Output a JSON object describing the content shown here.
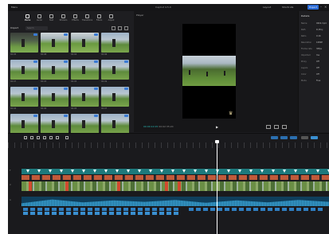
{
  "window": {
    "title": "CapCut 4.5.0",
    "export_label": "Export",
    "menu_left": "Menu",
    "layout_btn": "Layout",
    "shortcut_btn": "Shortcuts"
  },
  "media": {
    "tools": [
      {
        "label": "Media",
        "icon": "media-icon",
        "active": true
      },
      {
        "label": "Audio",
        "icon": "audio-icon"
      },
      {
        "label": "Text",
        "icon": "text-icon"
      },
      {
        "label": "Stickers",
        "icon": "sticker-icon"
      },
      {
        "label": "Effects",
        "icon": "effects-icon"
      },
      {
        "label": "Transitions",
        "icon": "transition-icon"
      },
      {
        "label": "Filters",
        "icon": "filter-icon"
      },
      {
        "label": "Adjust",
        "icon": "adjust-icon"
      }
    ],
    "import_label": "Import",
    "search_placeholder": "Search",
    "clips": [
      {
        "meta": "00:05",
        "style": "dark",
        "added": true
      },
      {
        "meta": "00:08",
        "style": "tall",
        "added": true
      },
      {
        "meta": "00:04",
        "style": "tall",
        "added": true
      },
      {
        "meta": "00:06",
        "style": "normal",
        "added": false
      },
      {
        "meta": "00:07",
        "style": "normal",
        "added": true
      },
      {
        "meta": "00:03",
        "style": "normal",
        "added": true
      },
      {
        "meta": "00:05",
        "style": "normal",
        "added": true
      },
      {
        "meta": "00:09",
        "style": "normal",
        "added": true
      },
      {
        "meta": "00:04",
        "style": "normal",
        "added": true
      },
      {
        "meta": "00:06",
        "style": "normal",
        "added": true
      },
      {
        "meta": "00:05",
        "style": "normal",
        "added": true
      },
      {
        "meta": "00:07",
        "style": "normal",
        "added": true
      },
      {
        "meta": "00:03",
        "style": "normal",
        "added": true
      },
      {
        "meta": "00:08",
        "style": "normal",
        "added": true
      },
      {
        "meta": "00:05",
        "style": "normal",
        "added": true
      },
      {
        "meta": "00:06",
        "style": "normal",
        "added": true
      }
    ]
  },
  "player": {
    "title": "Player",
    "time_current": "00:00:10:15",
    "time_total": "00:02:35:20"
  },
  "details": {
    "title": "Details",
    "rows": [
      {
        "key": "Name",
        "val": "0602.mp4"
      },
      {
        "key": "Path",
        "val": "D:/Proj"
      },
      {
        "key": "Ratio",
        "val": "9:16"
      },
      {
        "key": "Resolution",
        "val": "1080P"
      },
      {
        "key": "Frame rate",
        "val": "30fps"
      },
      {
        "key": "Imported",
        "val": "Yes"
      },
      {
        "key": "Proxy",
        "val": "Off"
      },
      {
        "key": "Layers",
        "val": "Off"
      },
      {
        "key": "Color",
        "val": "Off"
      },
      {
        "key": "Mode",
        "val": "Free"
      }
    ]
  },
  "timeline": {
    "lanes": [
      "T",
      "V",
      "A"
    ],
    "zoom": "fit"
  }
}
